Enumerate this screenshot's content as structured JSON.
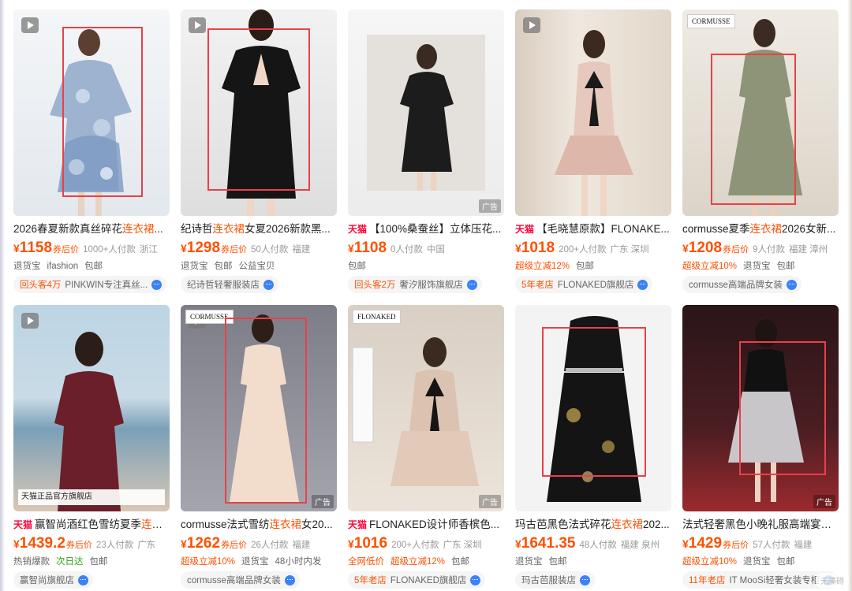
{
  "rows": [
    [
      {
        "has_play": true,
        "title_prefix": "",
        "title_main": "2026春夏新款真丝碎花",
        "title_hl": "连衣裙",
        "title_tail": "...",
        "currency": "¥",
        "price": "1158",
        "after_label": "券后价",
        "sold": "1000+人付款",
        "region": "浙江",
        "tags": [
          "退货宝",
          "ifashion",
          "包邮"
        ],
        "shop_badge": "回头客4万",
        "shop_name": "PINKWIN专注真丝...",
        "palette": [
          "#e9eef4",
          "#9fb4cf"
        ]
      },
      {
        "has_play": true,
        "title_prefix": "",
        "title_main": "纪诗哲",
        "title_hl": "连衣裙",
        "title_tail": "女夏2026新款黑...",
        "currency": "¥",
        "price": "1298",
        "after_label": "券后价",
        "sold": "50人付款",
        "region": "福建",
        "tags": [
          "退货宝",
          "包邮",
          "公益宝贝"
        ],
        "shop_badge": "",
        "shop_name": "纪诗哲轻奢服装店",
        "palette": [
          "#ededed",
          "#1b1b1b"
        ]
      },
      {
        "has_play": false,
        "title_prefix": "天猫",
        "title_main": "【100%桑蚕丝】立体压花...",
        "title_hl": "",
        "title_tail": "",
        "currency": "¥",
        "price": "1108",
        "after_label": "",
        "sold": "0人付款",
        "region": "中国",
        "tags": [
          "包邮"
        ],
        "shop_badge": "回头客2万",
        "shop_name": "奢汐服饰旗舰店",
        "palette": [
          "#eeeeee",
          "#222222"
        ]
      },
      {
        "has_play": true,
        "title_prefix": "天猫",
        "title_main": "【毛晓慧原款】FLONAKE...",
        "title_hl": "",
        "title_tail": "",
        "currency": "¥",
        "price": "1018",
        "after_label": "",
        "sold": "200+人付款",
        "region": "广东 深圳",
        "tags_promo": "超级立减12%",
        "tags": [
          "包邮"
        ],
        "shop_badge": "5年老店",
        "shop_name": "FLONAKED旗舰店",
        "palette": [
          "#e7ddd4",
          "#d9b8ad"
        ]
      },
      {
        "has_play": false,
        "title_prefix": "",
        "title_main": "cormusse夏季",
        "title_hl": "连衣裙",
        "title_tail": "2026女新...",
        "currency": "¥",
        "price": "1208",
        "after_label": "券后价",
        "sold": "9人付款",
        "region": "福建 漳州",
        "tags_promo": "超级立减10%",
        "tags": [
          "退货宝",
          "包邮"
        ],
        "shop_badge": "",
        "shop_name": "cormusse高端品牌女装",
        "palette": [
          "#ebe7df",
          "#8f9478"
        ]
      }
    ],
    [
      {
        "has_play": true,
        "title_prefix": "天猫",
        "title_main": "赢智尚酒红色雪纺夏季",
        "title_hl": "连衣...",
        "title_tail": "",
        "currency": "¥",
        "price": "1439.2",
        "after_label": "券后价",
        "sold": "23人付款",
        "region": "广东",
        "tags": [
          "热销爆款",
          "包邮"
        ],
        "tags_green": "次日达",
        "shop_badge": "",
        "shop_name": "赢智尚旗舰店",
        "store_banner": "天猫正品官方旗舰店",
        "palette": [
          "#b9d2e2",
          "#6b1f2a"
        ]
      },
      {
        "has_play": true,
        "title_prefix": "",
        "title_main": "cormusse法式雪纺",
        "title_hl": "连衣裙",
        "title_tail": "女20...",
        "currency": "¥",
        "price": "1262",
        "after_label": "券后价",
        "sold": "26人付款",
        "region": "福建",
        "tags_promo": "超级立减10%",
        "tags": [
          "退货宝",
          "48小时内发"
        ],
        "shop_badge": "",
        "shop_name": "cormusse高端品牌女装",
        "brandmark": "CORMUSSE",
        "palette": [
          "#8c8c96",
          "#f1dccb"
        ]
      },
      {
        "has_play": false,
        "title_prefix": "天猫",
        "title_main": "FLONAKED设计师香槟色...",
        "title_hl": "",
        "title_tail": "",
        "currency": "¥",
        "price": "1016",
        "after_label": "",
        "sold": "200+人付款",
        "region": "广东 深圳",
        "tags_promo": "全网低价",
        "tags_promo2": "超级立减12%",
        "tags": [
          "包邮"
        ],
        "shop_badge": "5年老店",
        "shop_name": "FLONAKED旗舰店",
        "brandmark": "FLONAKED",
        "palette": [
          "#e6dcd0",
          "#d9bfae"
        ]
      },
      {
        "has_play": false,
        "title_prefix": "",
        "title_main": "玛古芭黑色法式碎花",
        "title_hl": "连衣裙",
        "title_tail": "202...",
        "currency": "¥",
        "price": "1641.35",
        "after_label": "",
        "sold": "48人付款",
        "region": "福建 泉州",
        "tags": [
          "退货宝",
          "包邮"
        ],
        "shop_badge": "",
        "shop_name": "玛古芭服装店",
        "palette": [
          "#f2f2f2",
          "#141414"
        ]
      },
      {
        "has_play": false,
        "title_prefix": "",
        "title_main": "法式轻奢黑色小晚礼服高端宴会...",
        "title_hl": "",
        "title_tail": "",
        "currency": "¥",
        "price": "1429",
        "after_label": "券后价",
        "sold": "57人付款",
        "region": "福建",
        "tags_promo": "超级立减10%",
        "tags": [
          "退货宝",
          "包邮"
        ],
        "shop_badge": "11年老店",
        "shop_name": "IT MooSi轻奢女装专柜",
        "palette": [
          "#3a1a1e",
          "#9b2a2e"
        ]
      }
    ]
  ],
  "ad_label": "广告",
  "floating_hint": "无障碍"
}
